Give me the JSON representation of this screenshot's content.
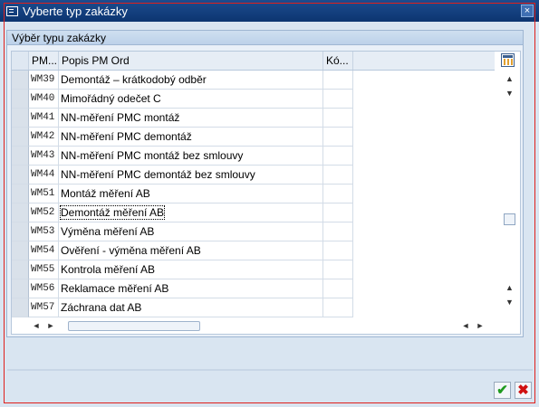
{
  "window": {
    "title": "Vyberte typ zakázky",
    "close_glyph": "×"
  },
  "group": {
    "title": "Výběr typu zakázky"
  },
  "table": {
    "columns": [
      "PM...",
      "Popis PM Ord",
      "Kó..."
    ],
    "rows": [
      {
        "code": "WM39",
        "desc": "Demontáž – krátkodobý odběr",
        "ko": ""
      },
      {
        "code": "WM40",
        "desc": "Mimořádný odečet C",
        "ko": ""
      },
      {
        "code": "WM41",
        "desc": "NN-měření PMC montáž",
        "ko": ""
      },
      {
        "code": "WM42",
        "desc": "NN-měření PMC demontáž",
        "ko": ""
      },
      {
        "code": "WM43",
        "desc": "NN-měření PMC montáž bez smlouvy",
        "ko": ""
      },
      {
        "code": "WM44",
        "desc": "NN-měření PMC demontáž bez smlouvy",
        "ko": ""
      },
      {
        "code": "WM51",
        "desc": "Montáž měření AB",
        "ko": ""
      },
      {
        "code": "WM52",
        "desc": "Demontáž měření AB",
        "ko": ""
      },
      {
        "code": "WM53",
        "desc": "Výměna měření  AB",
        "ko": ""
      },
      {
        "code": "WM54",
        "desc": "Ověření - výměna měření AB",
        "ko": ""
      },
      {
        "code": "WM55",
        "desc": "Kontrola měření AB",
        "ko": ""
      },
      {
        "code": "WM56",
        "desc": "Reklamace měření AB",
        "ko": ""
      },
      {
        "code": "WM57",
        "desc": "Záchrana dat AB",
        "ko": ""
      }
    ],
    "focused_row_index": 7
  },
  "scroll": {
    "up_arrow": "▲",
    "down_arrow": "▼",
    "left_arrow": "◄",
    "right_arrow": "►"
  },
  "buttons": {
    "ok_glyph": "✔",
    "cancel_glyph": "✖"
  },
  "colors": {
    "titlebar": "#1d4c8f",
    "highlight_frame": "#e0201c",
    "ok": "#1f9a1f",
    "cancel": "#d01010"
  }
}
